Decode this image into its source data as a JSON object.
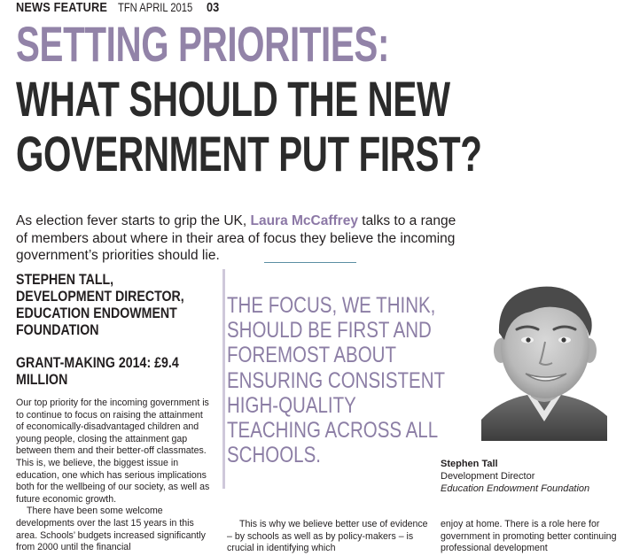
{
  "header": {
    "section": "NEWS FEATURE",
    "issue": "TFN APRIL 2015",
    "page": "03"
  },
  "headline": {
    "line1": "SETTING PRIORITIES:",
    "line2": "WHAT SHOULD THE NEW",
    "line3": "GOVERNMENT PUT FIRST?"
  },
  "intro": {
    "before": "As election fever starts to grip the UK, ",
    "author": "Laura McCaffrey",
    "after": " talks to a range of members about where in their area of focus they believe the incoming government’s priorities should lie."
  },
  "profile": {
    "name_title": "STEPHEN TALL, DEVELOPMENT DIRECTOR, EDUCATION ENDOWMENT FOUNDATION",
    "grant": "GRANT-MAKING 2014: £9.4 MILLION"
  },
  "body": {
    "para1": "Our top priority for the incoming government is to continue to focus on raising the attainment of economically-disadvantaged children and young people, closing the attainment gap between them and their better-off classmates. This is, we believe, the biggest issue in education, one which has serious implications both for the wellbeing of our society, as well as future economic growth.",
    "para2": "There have been some welcome developments over the last 15 years in this area. Schools’ budgets increased significantly from 2000 until the financial",
    "mid_column": "This is why we believe better use of evidence – by schools as well as by policy-makers – is crucial in identifying which",
    "right_column": "enjoy at home. There is a role here for government in promoting better continuing professional development"
  },
  "pull_quote": "THE FOCUS, WE THINK, SHOULD BE FIRST AND FOREMOST ABOUT ENSURING CONSISTENT HIGH-QUALITY TEACHING ACROSS ALL SCHOOLS.",
  "caption": {
    "name": "Stephen Tall",
    "role": "Development Director",
    "org": "Education Endowment Foundation"
  },
  "colors": {
    "accent_purple": "#9283a8",
    "headline_dark": "#2b2b2b",
    "rule_blue": "#5b8fa3"
  }
}
